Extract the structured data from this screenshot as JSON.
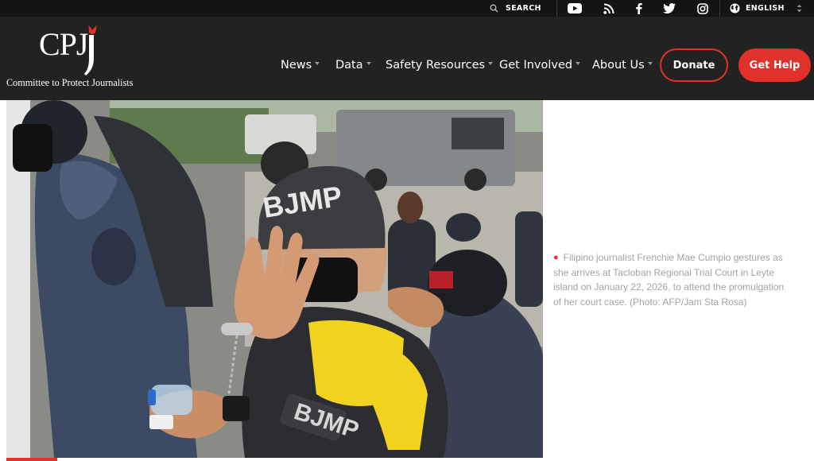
{
  "topbar": {
    "search_label": "SEARCH",
    "social_icons": [
      "youtube-icon",
      "rss-icon",
      "facebook-icon",
      "twitter-icon",
      "instagram-icon"
    ],
    "language_label": "ENGLISH"
  },
  "header": {
    "logo_text": "CPJ",
    "tagline": "Committee to Protect Journalists",
    "nav": [
      {
        "label": "News"
      },
      {
        "label": "Data"
      },
      {
        "label": "Safety Resources"
      },
      {
        "label": "Get Involved"
      },
      {
        "label": "About Us"
      }
    ],
    "donate_label": "Donate",
    "help_label": "Get Help"
  },
  "photo": {
    "helmet_text": "BJMP",
    "vest_text": "BJMP",
    "patch_text": "BJMP"
  },
  "caption": {
    "text": "Filipino journalist Frenchie Mae Cumpio gestures as she arrives at Tacloban Regional Trial Court in Leyte island on January 22, 2026, to attend the promulgation of her court case. (Photo: AFP/Jam Sta Rosa)"
  },
  "colors": {
    "accent": "#e0312b",
    "header_bg": "#222222",
    "topbar_bg": "#141414",
    "caption_text": "#a3a3a3"
  }
}
